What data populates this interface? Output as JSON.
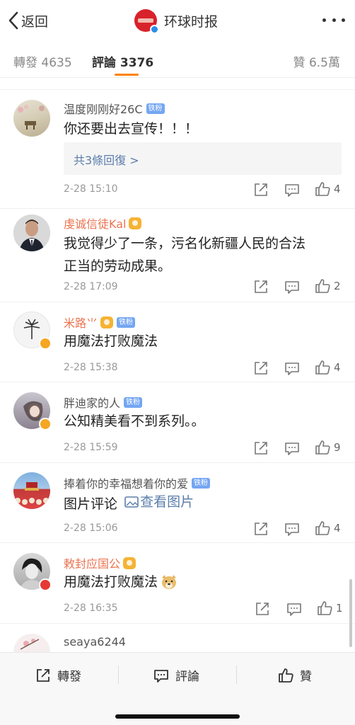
{
  "nav": {
    "back_label": "返回",
    "title": "环球时报"
  },
  "tabs": {
    "repost": "轉發 4635",
    "comments": "評論 3376",
    "likes": "贊 6.5萬"
  },
  "comments": [
    {
      "name": "温度刚刚好26C",
      "badge": "铁粉",
      "text": "你还要出去宣传！！！",
      "reply_label": "共3條回復 >",
      "time": "2-28 15:10",
      "likes": "4"
    },
    {
      "name": "虔诚信徒Kal",
      "text_line1": "我觉得少了一条，污名化新疆人民的合法",
      "text_line2": "正当的劳动成果。",
      "time": "2-28 17:09",
      "likes": "2"
    },
    {
      "name": "米路⺌",
      "badge": "铁粉",
      "text": "用魔法打败魔法",
      "time": "2-28 15:38",
      "likes": "4"
    },
    {
      "name": "胖迪家的人",
      "badge": "铁粉",
      "text": "公知精美看不到系列。。",
      "time": "2-28 15:59",
      "likes": "9"
    },
    {
      "name": "捧着你的幸福想着你的爱",
      "badge": "铁粉",
      "text": "图片评论",
      "link": "查看图片",
      "time": "2-28 15:06",
      "likes": "4"
    },
    {
      "name": "敕封应国公",
      "text": "用魔法打败魔法",
      "time": "2-28 16:35",
      "likes": "1"
    },
    {
      "name": "seaya6244"
    }
  ],
  "bottom": {
    "repost": "轉發",
    "comment": "評論",
    "like": "贊"
  },
  "colors": {
    "accent": "#ff8200",
    "orange_name": "#eb7350",
    "link": "#5b7eaa",
    "badge_blue": "#74a6f2"
  }
}
